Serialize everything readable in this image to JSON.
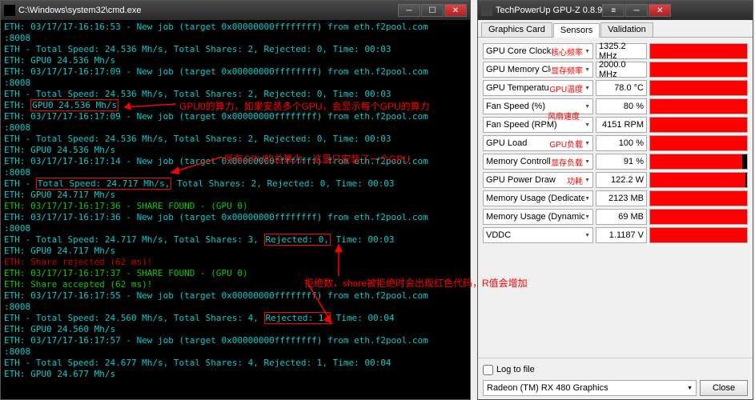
{
  "cmd": {
    "title": "C:\\Windows\\system32\\cmd.exe",
    "lines": [
      {
        "t": "ETH: 03/17/17-16:16:53 - New job (target 0x00000000ffffffff) from eth.f2pool.com:8008",
        "c": "t-cyan"
      },
      {
        "t": "ETH - Total Speed: 24.536 Mh/s, Total Shares: 2, Rejected: 0, Time: 00:03",
        "c": "t-cyan"
      },
      {
        "t": "ETH: GPU0 24.536 Mh/s",
        "c": "t-cyan"
      },
      {
        "t": "ETH: 03/17/17-16:17:09 - New job (target 0x00000000ffffffff) from eth.f2pool.com:8008",
        "c": "t-cyan"
      },
      {
        "t": "ETH - Total Speed: 24.536 Mh/s, Total Shares: 2, Rejected: 0, Time: 00:03",
        "c": "t-cyan"
      },
      {
        "t": "ETH: ",
        "c": "t-cyan",
        "box": "GPU0 24.536 Mh/s"
      },
      {
        "t": "ETH: 03/17/17-16:17:09 - New job (target 0x00000000ffffffff) from eth.f2pool.com:8008",
        "c": "t-cyan"
      },
      {
        "t": "ETH - Total Speed: 24.536 Mh/s, Total Shares: 2, Rejected: 0, Time: 00:03",
        "c": "t-cyan"
      },
      {
        "t": "ETH: GPU0 24.536 Mh/s",
        "c": "t-cyan"
      },
      {
        "t": "ETH: 03/17/17-16:17:14 - New job (target 0x00000000ffffffff) from eth.f2pool.com:8008",
        "c": "t-cyan"
      },
      {
        "t": "ETH - ",
        "c": "t-cyan",
        "box": "Total Speed: 24.717 Mh/s,",
        "tail": " Total Shares: 2, Rejected: 0, Time: 00:03"
      },
      {
        "t": "ETH: GPU0 24.717 Mh/s",
        "c": "t-cyan"
      },
      {
        "t": "ETH: 03/17/17-16:17:36 - SHARE FOUND - (GPU 0)",
        "c": "t-green"
      },
      {
        "t": "ETH: 03/17/17-16:17:36 - New job (target 0x00000000ffffffff) from eth.f2pool.com:8008",
        "c": "t-cyan"
      },
      {
        "t": "ETH - Total Speed: 24.717 Mh/s, Total Shares: 3, ",
        "c": "t-cyan",
        "box": "Rejected: 0,",
        "tail": " Time: 00:03"
      },
      {
        "t": "ETH: GPU0 24.717 Mh/s",
        "c": "t-cyan"
      },
      {
        "t": "ETH: Share rejected (62 ms)!",
        "c": "t-red"
      },
      {
        "t": "ETH: 03/17/17-16:17:37 - SHARE FOUND - (GPU 0)",
        "c": "t-green"
      },
      {
        "t": "ETH: Share accepted (62 ms)!",
        "c": "t-green"
      },
      {
        "t": "ETH: 03/17/17-16:17:55 - New job (target 0x00000000ffffffff) from eth.f2pool.com:8008",
        "c": "t-cyan"
      },
      {
        "t": "ETH - Total Speed: 24.560 Mh/s, Total Shares: 4, ",
        "c": "t-cyan",
        "box": "Rejected: 1,",
        "tail": " Time: 00:04"
      },
      {
        "t": "ETH: GPU0 24.560 Mh/s",
        "c": "t-cyan"
      },
      {
        "t": "ETH: 03/17/17-16:17:57 - New job (target 0x00000000ffffffff) from eth.f2pool.com:8008",
        "c": "t-cyan"
      },
      {
        "t": "ETH - Total Speed: 24.677 Mh/s, Total Shares: 4, Rejected: 1, Time: 00:04",
        "c": "t-cyan"
      },
      {
        "t": "ETH: GPU0 24.677 Mh/s",
        "c": "t-cyan"
      }
    ]
  },
  "gpuz": {
    "title": "TechPowerUp GPU-Z 0.8.9",
    "tabs": {
      "graphics": "Graphics Card",
      "sensors": "Sensors",
      "validation": "Validation"
    },
    "sensors": [
      {
        "name": "GPU Core Clock",
        "anno": "核心频率",
        "value": "1325.2 MHz",
        "fill": 100
      },
      {
        "name": "GPU Memory Clock",
        "anno": "显存频率",
        "value": "2000.0 MHz",
        "fill": 100
      },
      {
        "name": "GPU Temperature",
        "anno": "GPU温度",
        "value": "78.0 °C",
        "fill": 100
      },
      {
        "name": "Fan Speed (%)",
        "anno": "",
        "value": "80 %",
        "fill": 100
      },
      {
        "name": "Fan Speed (RPM)",
        "anno": "风扇速度",
        "anno_above": true,
        "value": "4151 RPM",
        "fill": 100
      },
      {
        "name": "GPU Load",
        "anno": "GPU负载",
        "value": "100 %",
        "fill": 100
      },
      {
        "name": "Memory Controller Load",
        "anno": "显存负载",
        "value": "91 %",
        "fill": 95
      },
      {
        "name": "GPU Power Draw",
        "anno": "功耗",
        "value": "122.2 W",
        "fill": 98
      },
      {
        "name": "Memory Usage (Dedicated)",
        "anno": "",
        "value": "2123 MB",
        "fill": 100
      },
      {
        "name": "Memory Usage (Dynamic)",
        "anno": "",
        "value": "69 MB",
        "fill": 100
      },
      {
        "name": "VDDC",
        "anno": "",
        "value": "1.1187 V",
        "fill": 100
      }
    ],
    "logLabel": "Log to file",
    "gpuName": "Radeon (TM) RX 480 Graphics",
    "closeLabel": "Close"
  },
  "annotations": {
    "a1": "GPU0的算力，如果安装多个GPU，会显示每个GPU的算力",
    "a2": "所有GPU的总算力，这里只安装了一个GPU",
    "a3": "拒绝数，share被拒绝时会出现红色代码，R值会增加"
  }
}
